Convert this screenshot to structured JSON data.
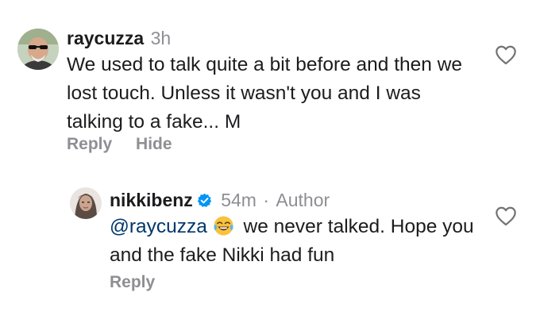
{
  "comments": [
    {
      "username": "raycuzza",
      "time": "3h",
      "text": "We used to talk quite a bit before and then we lost touch. Unless it wasn't you and I was talking to a fake... M",
      "actions": {
        "reply": "Reply",
        "hide": "Hide"
      },
      "avatar_icon": "man-with-sunglasses-avatar"
    },
    {
      "username": "nikkibenz",
      "verified": true,
      "time": "54m",
      "separator": "·",
      "author_label": "Author",
      "mention": "@raycuzza",
      "emoji": "😂",
      "text": "we never talked. Hope you and the fake Nikki had fun",
      "actions": {
        "reply": "Reply"
      },
      "avatar_icon": "woman-portrait-avatar"
    }
  ],
  "colors": {
    "username": "#1c1c1e",
    "meta": "#8e8e93",
    "mention": "#00376b",
    "verified": "#0095f6",
    "heart_outline": "#737373"
  }
}
